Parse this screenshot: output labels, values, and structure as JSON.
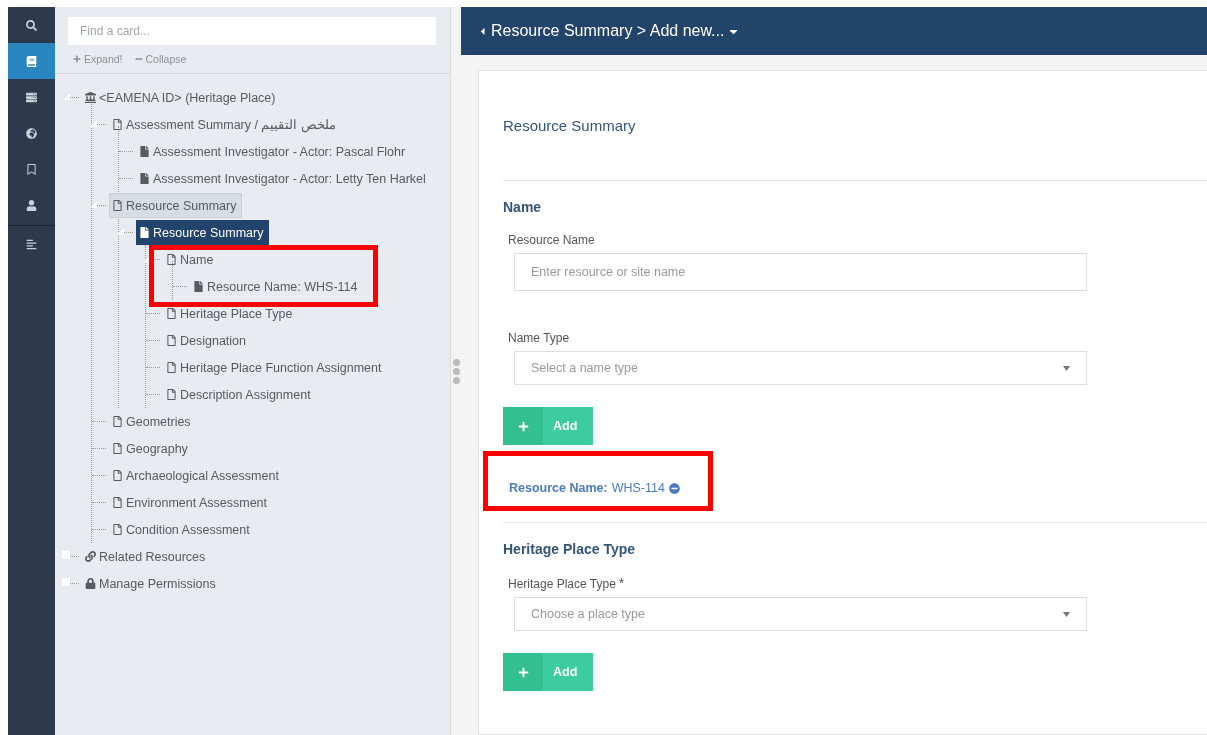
{
  "nav_rail": [
    {
      "selected": false
    },
    {
      "selected": true
    },
    {
      "selected": false
    },
    {
      "selected": false
    },
    {
      "selected": false
    },
    {
      "selected": false
    },
    {
      "selected": false
    }
  ],
  "card_tree": {
    "search": {
      "placeholder": "Find a card..."
    },
    "expand_label": "Expand!",
    "collapse_label": "Collapse",
    "nodes": [
      {
        "label": "<EAMENA ID> (Heritage Place)",
        "kind": "museum",
        "selected": false,
        "active": false,
        "expanded": true,
        "children": [
          {
            "label": "Assessment Summary / ملخص التقييم",
            "kind": "card",
            "selected": false,
            "active": false,
            "expanded": true,
            "children": [
              {
                "label": "Assessment Investigator - Actor: Pascal Flohr",
                "kind": "record",
                "selected": false,
                "active": false
              },
              {
                "label": "Assessment Investigator - Actor: Letty Ten Harkel",
                "kind": "record",
                "selected": false,
                "active": false
              }
            ]
          },
          {
            "label": "Resource Summary",
            "kind": "card",
            "selected": false,
            "active": true,
            "expanded": true,
            "children": [
              {
                "label": "Resource Summary",
                "kind": "record",
                "selected": true,
                "active": false,
                "expanded": true,
                "children": [
                  {
                    "label": "Name",
                    "kind": "card",
                    "selected": false,
                    "active": false,
                    "expanded": true,
                    "annotated": true,
                    "children": [
                      {
                        "label": "Resource Name: WHS-114",
                        "kind": "record",
                        "selected": false,
                        "active": false
                      }
                    ]
                  },
                  {
                    "label": "Heritage Place Type",
                    "kind": "card",
                    "selected": false,
                    "active": false
                  },
                  {
                    "label": "Designation",
                    "kind": "card",
                    "selected": false,
                    "active": false
                  },
                  {
                    "label": "Heritage Place Function Assignment",
                    "kind": "card",
                    "selected": false,
                    "active": false
                  },
                  {
                    "label": "Description Assignment",
                    "kind": "card",
                    "selected": false,
                    "active": false
                  }
                ]
              }
            ]
          },
          {
            "label": "Geometries",
            "kind": "card",
            "selected": false,
            "active": false
          },
          {
            "label": "Geography",
            "kind": "card",
            "selected": false,
            "active": false
          },
          {
            "label": "Archaeological Assessment",
            "kind": "card",
            "selected": false,
            "active": false
          },
          {
            "label": "Environment Assessment",
            "kind": "card",
            "selected": false,
            "active": false
          },
          {
            "label": "Condition Assessment",
            "kind": "card",
            "selected": false,
            "active": false
          }
        ]
      },
      {
        "label": "Related Resources",
        "kind": "link",
        "selected": false,
        "active": false,
        "expanded": false
      },
      {
        "label": "Manage Permissions",
        "kind": "lock",
        "selected": false,
        "active": false,
        "expanded": false
      }
    ]
  },
  "header": {
    "breadcrumb": "Resource Summary > Add new..."
  },
  "form": {
    "title": "Resource Summary",
    "sections": [
      {
        "heading": "Name",
        "fields": [
          {
            "kind": "input",
            "label": "Resource Name",
            "placeholder": "Enter resource or site name"
          },
          {
            "kind": "select",
            "label": "Name Type",
            "placeholder": "Select a name type"
          }
        ],
        "add_label": "Add",
        "saved": [
          {
            "label": "Resource Name:",
            "value": "WHS-114",
            "annotated": true
          }
        ]
      },
      {
        "heading": "Heritage Place Type",
        "fields": [
          {
            "kind": "select",
            "label": "Heritage Place Type",
            "required_mark": "*",
            "placeholder": "Choose a place type"
          }
        ],
        "add_label": "Add"
      }
    ]
  }
}
